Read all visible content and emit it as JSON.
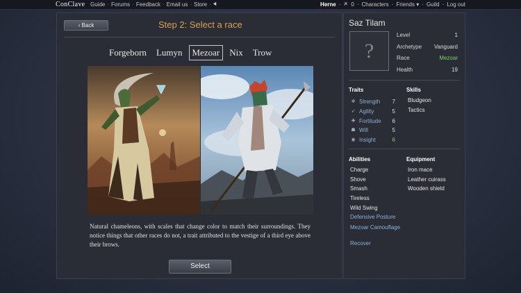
{
  "topbar": {
    "logo": "ConClave",
    "nav": [
      "Guide",
      "Forums",
      "Feedback",
      "Email us",
      "Store"
    ],
    "user": "Herne",
    "coins": "0",
    "characters": "Characters",
    "friends": "Friends",
    "guild": "Guild",
    "logout": "Log out"
  },
  "main": {
    "back_label": "‹ Back",
    "step_title": "Step 2: Select a race",
    "tabs": [
      "Forgeborn",
      "Lumyn",
      "Mezoar",
      "Nix",
      "Trow"
    ],
    "active_tab": "Mezoar",
    "description": "Natural chameleons, with scales that change color to match their surroundings. They notice things that other races do not, a trait attributed to the vestige of a third eye above their brows.",
    "select_label": "Select"
  },
  "sheet": {
    "name": "Saz Tilam",
    "portrait_placeholder": "?",
    "stats": [
      {
        "label": "Level",
        "value": "1"
      },
      {
        "label": "Archetype",
        "value": "Vanguard"
      },
      {
        "label": "Race",
        "value": "Mezoar"
      },
      {
        "label": "Health",
        "value": "19"
      }
    ],
    "traits_header": "Traits",
    "skills_header": "Skills",
    "traits": [
      {
        "name": "Strength",
        "value": "7",
        "icon": "strength-icon"
      },
      {
        "name": "Agility",
        "value": "5",
        "icon": "agility-icon"
      },
      {
        "name": "Fortitude",
        "value": "6",
        "icon": "fortitude-icon"
      },
      {
        "name": "Will",
        "value": "5",
        "icon": "will-icon"
      },
      {
        "name": "Insight",
        "value": "6",
        "icon": "insight-icon"
      }
    ],
    "skills": [
      "Bludgeon",
      "Tactics"
    ],
    "abilities_header": "Abilities",
    "equipment_header": "Equipment",
    "abilities": [
      "Charge",
      "Shove",
      "Smash",
      "Tireless",
      "Wild Swing",
      "Defensive Posture",
      "Mezoar Camouflage",
      "Recover"
    ],
    "equipment": [
      "Iron mace",
      "Leather cuirass",
      "Wooden shield"
    ],
    "colors": {
      "highlight_green": "#7fcf6a",
      "accent_orange": "#d8a24e",
      "link_blue": "#8eb0d8"
    }
  }
}
